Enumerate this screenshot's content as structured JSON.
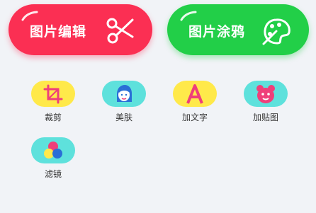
{
  "actions": {
    "edit_label": "图片编辑",
    "draw_label": "图片涂鸦"
  },
  "tools": [
    {
      "label": "裁剪",
      "icon": "crop-icon"
    },
    {
      "label": "美肤",
      "icon": "face-icon"
    },
    {
      "label": "加文字",
      "icon": "text-icon"
    },
    {
      "label": "加贴图",
      "icon": "bear-sticker-icon"
    },
    {
      "label": "滤镜",
      "icon": "filter-circles-icon"
    }
  ],
  "colors": {
    "edit_button": "#fb2f53",
    "draw_button": "#22cf48",
    "tool_yellow": "#ffe94a",
    "tool_cyan": "#5ee1dc",
    "background": "#f1f3f7"
  }
}
